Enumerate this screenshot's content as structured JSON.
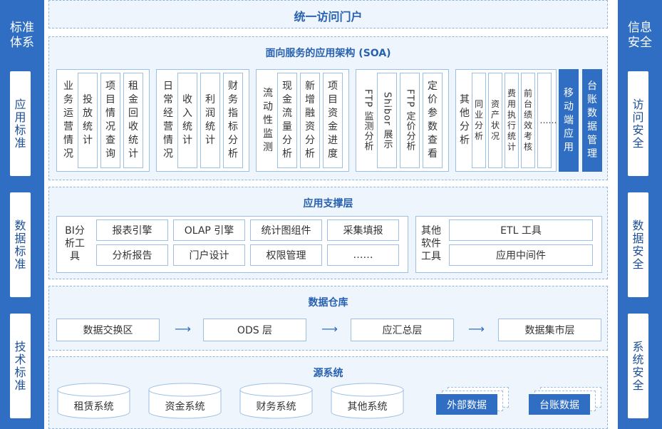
{
  "left_bar": {
    "title": "标准体系",
    "items": [
      "应用标准",
      "数据标准",
      "技术标准"
    ]
  },
  "right_bar": {
    "title": "信息安全",
    "items": [
      "访问安全",
      "数据安全",
      "系统安全"
    ]
  },
  "portal": {
    "title": "统一访问门户"
  },
  "soa": {
    "title": "面向服务的应用架构 (SOA)",
    "groups": [
      {
        "items": [
          "业务运营情况",
          "投放统计",
          "项目情况查询",
          "租金回收统计"
        ]
      },
      {
        "items": [
          "日常经营情况",
          "收入统计",
          "利润统计",
          "财务指标分析"
        ]
      },
      {
        "items": [
          "流动性监测",
          "现金流量分析",
          "新增融资分析",
          "项目资金进度"
        ]
      },
      {
        "items": [
          "FTP 监测分析",
          "Shibor 展示",
          "FTP 定价分析",
          "定价参数查看"
        ]
      },
      {
        "items": [
          "其他分析",
          "同业分析",
          "资产状况",
          "费用执行统计",
          "前台绩效考核",
          "……"
        ]
      }
    ],
    "highlight": [
      "移动端应用",
      "台账数据管理"
    ]
  },
  "support": {
    "title": "应用支撑层",
    "bi_label": "BI分析工具",
    "bi_items": [
      "报表引擎",
      "OLAP 引擎",
      "统计图组件",
      "采集填报",
      "分析报告",
      "门户设计",
      "权限管理",
      "……"
    ],
    "other_label": "其他软件工具",
    "other_items": [
      "ETL 工具",
      "应用中间件"
    ]
  },
  "warehouse": {
    "title": "数据仓库",
    "layers": [
      "数据交换区",
      "ODS 层",
      "应汇总层",
      "数据集市层"
    ],
    "arrow": "⟶"
  },
  "source": {
    "title": "源系统",
    "systems": [
      "租赁系统",
      "资金系统",
      "财务系统",
      "其他系统"
    ],
    "external": [
      "外部数据",
      "台账数据"
    ]
  },
  "colors": {
    "primary": "#2f6ec2",
    "panel": "#eef5fc",
    "border": "#9cbfe6"
  }
}
